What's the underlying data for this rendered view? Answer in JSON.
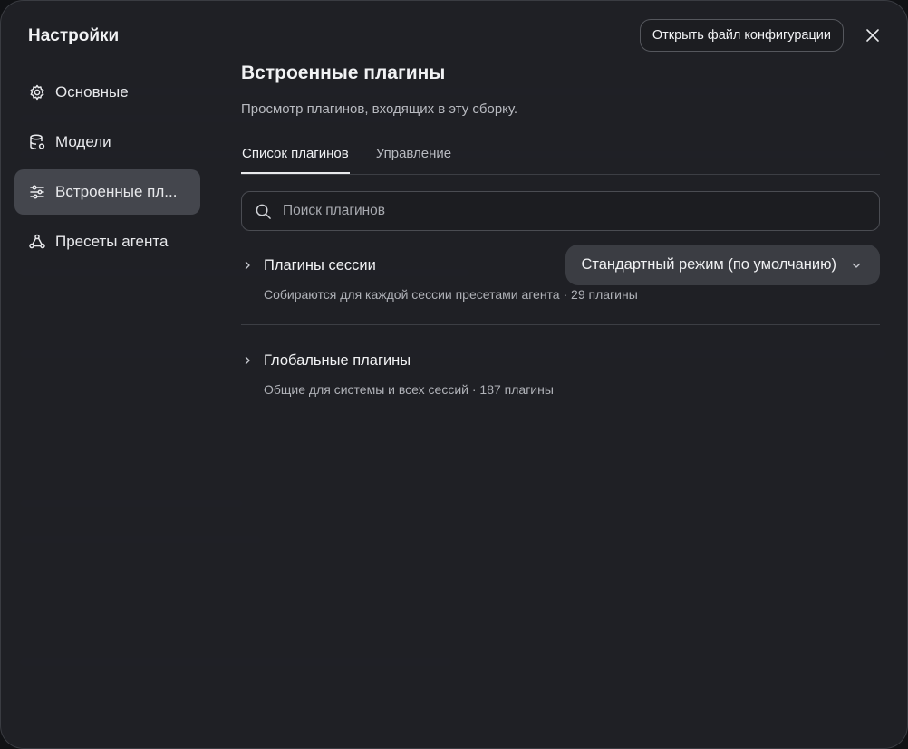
{
  "modal": {
    "title": "Настройки",
    "open_config_label": "Открыть файл конфигурации"
  },
  "sidebar": {
    "items": [
      {
        "label": "Основные",
        "icon": "gear-icon",
        "active": false
      },
      {
        "label": "Модели",
        "icon": "database-icon",
        "active": false
      },
      {
        "label": "Встроенные пл...",
        "icon": "sliders-icon",
        "active": true
      },
      {
        "label": "Пресеты агента",
        "icon": "agent-icon",
        "active": false
      }
    ]
  },
  "main": {
    "title": "Встроенные плагины",
    "subtitle": "Просмотр плагинов, входящих в эту сборку.",
    "tabs": [
      {
        "label": "Список плагинов",
        "active": true
      },
      {
        "label": "Управление",
        "active": false
      }
    ],
    "search": {
      "placeholder": "Поиск плагинов",
      "value": ""
    },
    "groups": [
      {
        "title": "Плагины сессии",
        "description": "Собираются для каждой сессии пресетами агента",
        "count": "· 29 плагины",
        "mode_select": "Стандартный режим (по умолчанию)"
      },
      {
        "title": "Глобальные плагины",
        "description": "Общие для системы и всех сессий",
        "count": "· 187 плагины"
      }
    ]
  },
  "colors": {
    "modal_bg": "#202126",
    "active_nav_bg": "#44464d",
    "select_bg": "#3b3d43",
    "text_primary": "#f1f2f4",
    "text_secondary": "#b8bac0"
  }
}
